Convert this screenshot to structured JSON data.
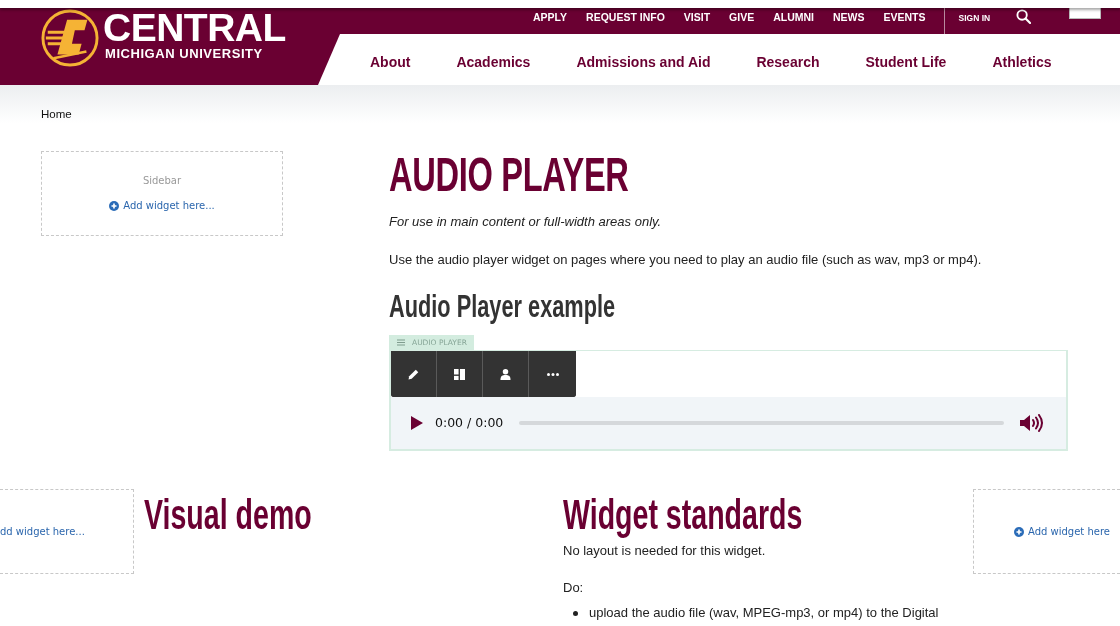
{
  "header": {
    "logo": {
      "wordmark": "CENTRAL",
      "subtitle": "MICHIGAN UNIVERSITY"
    },
    "utility_links": [
      "APPLY",
      "REQUEST INFO",
      "VISIT",
      "GIVE",
      "ALUMNI",
      "NEWS",
      "EVENTS"
    ],
    "sign_in": "SIGN IN",
    "main_nav": [
      "About",
      "Academics",
      "Admissions and Aid",
      "Research",
      "Student Life",
      "Athletics"
    ]
  },
  "breadcrumb": [
    "Home"
  ],
  "sidebar": {
    "label": "Sidebar",
    "add_widget": "Add widget here..."
  },
  "main": {
    "title": "AUDIO PLAYER",
    "note": "For use in main content or full-width areas only.",
    "intro": "Use the audio player widget on pages where you need to play an audio file (such as wav, mp3 or mp4).",
    "example_heading": "Audio Player example",
    "widget": {
      "label": "AUDIO PLAYER",
      "toolbar": [
        {
          "kind": "edit"
        },
        {
          "kind": "layout"
        },
        {
          "kind": "user"
        },
        {
          "kind": "more"
        }
      ],
      "player": {
        "time": "0:00 / 0:00"
      }
    }
  },
  "lower": {
    "left_region": {
      "add_widget": "dd widget here..."
    },
    "visual_demo": {
      "heading": "Visual demo"
    },
    "widget_standards": {
      "heading": "Widget standards",
      "paragraphs": [
        "No layout is needed for this widget.",
        "Do:"
      ],
      "list": [
        "upload the audio file (wav, MPEG-mp3, or mp4) to the Digital"
      ]
    },
    "right_region": {
      "add_widget": "Add widget here"
    }
  }
}
